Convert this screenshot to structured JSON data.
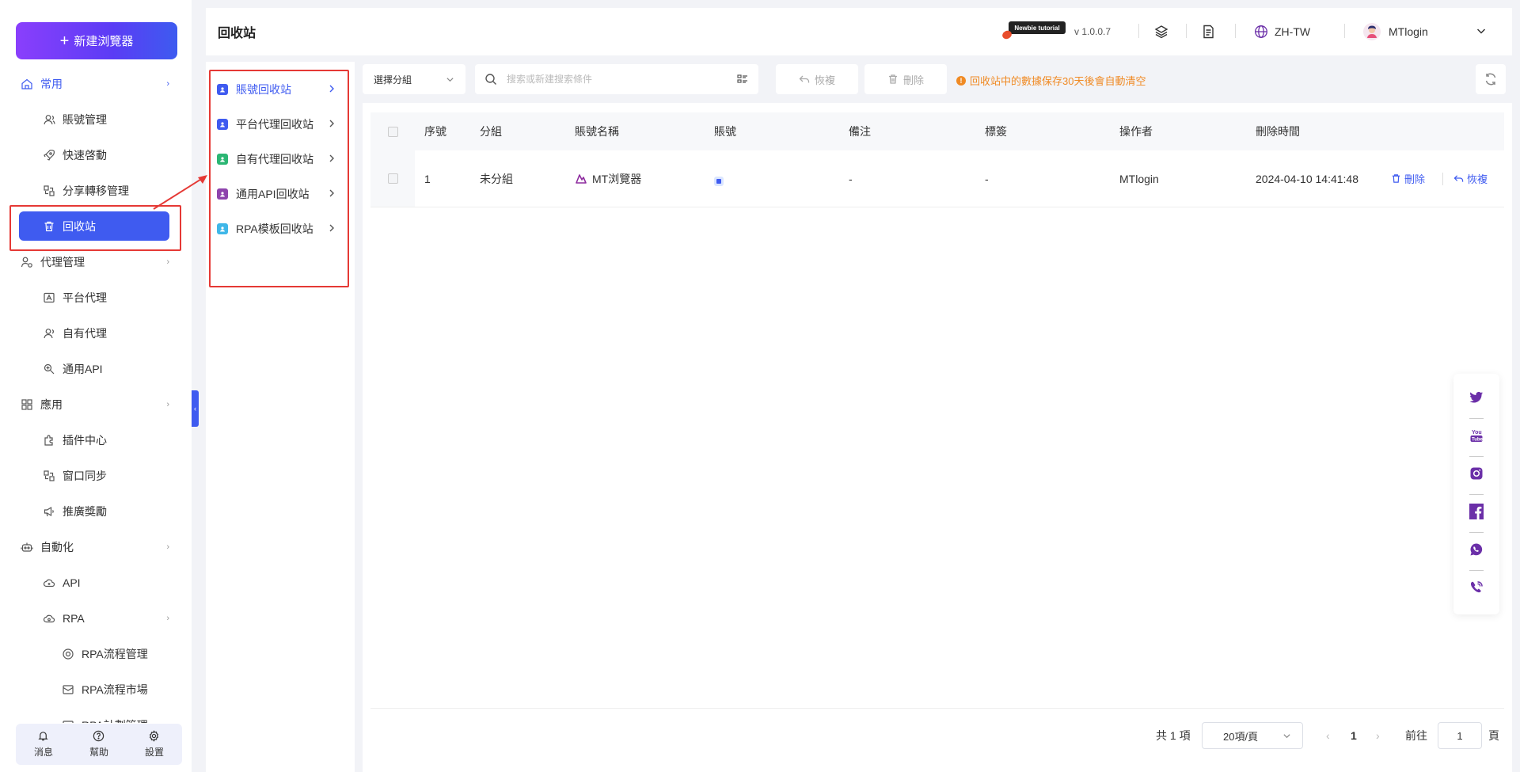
{
  "sidebar": {
    "new_browser": "新建浏覽器",
    "items": [
      {
        "label": "常用",
        "level": 1,
        "icon": "home-icon",
        "arrow": "›"
      },
      {
        "label": "賬號管理",
        "level": 2,
        "icon": "user-icon"
      },
      {
        "label": "快速啓動",
        "level": 2,
        "icon": "rocket-icon"
      },
      {
        "label": "分享轉移管理",
        "level": 2,
        "icon": "share-icon"
      },
      {
        "label": "回收站",
        "level": 2,
        "icon": "trash-icon",
        "active": true
      },
      {
        "label": "代理管理",
        "level": 1,
        "icon": "proxy-icon",
        "arrow": "›"
      },
      {
        "label": "平台代理",
        "level": 2,
        "icon": "platform-icon"
      },
      {
        "label": "自有代理",
        "level": 2,
        "icon": "user-proxy-icon"
      },
      {
        "label": "通用API",
        "level": 2,
        "icon": "api-icon"
      },
      {
        "label": "應用",
        "level": 1,
        "icon": "apps-icon",
        "arrow": "›"
      },
      {
        "label": "插件中心",
        "level": 2,
        "icon": "plugin-icon"
      },
      {
        "label": "窗口同步",
        "level": 2,
        "icon": "sync-icon"
      },
      {
        "label": "推廣獎勵",
        "level": 2,
        "icon": "megaphone-icon"
      },
      {
        "label": "自動化",
        "level": 1,
        "icon": "robot-icon",
        "arrow": "›"
      },
      {
        "label": "API",
        "level": 2,
        "icon": "cloud-icon"
      },
      {
        "label": "RPA",
        "level": 2,
        "icon": "rpa-icon",
        "arrow": "›"
      },
      {
        "label": "RPA流程管理",
        "level": 3,
        "icon": "flow-icon"
      },
      {
        "label": "RPA流程市場",
        "level": 3,
        "icon": "market-icon"
      },
      {
        "label": "RPA計劃管理",
        "level": 3,
        "icon": "plan-icon"
      }
    ],
    "bottom": [
      {
        "label": "消息",
        "icon": "bell-icon"
      },
      {
        "label": "幫助",
        "icon": "help-icon"
      },
      {
        "label": "設置",
        "icon": "gear-icon"
      }
    ],
    "collapse": "‹"
  },
  "header": {
    "title": "回收站",
    "tutorial": "Newbie tutorial",
    "version": "v 1.0.0.7",
    "language": "ZH-TW",
    "user": "MTlogin"
  },
  "subnav": [
    {
      "label": "賬號回收站",
      "active": true,
      "color": "#3f5bf0"
    },
    {
      "label": "平台代理回收站",
      "active": false,
      "color": "#3f5bf0"
    },
    {
      "label": "自有代理回收站",
      "active": false,
      "color": "#2bb673"
    },
    {
      "label": "通用API回收站",
      "active": false,
      "color": "#8e44ad"
    },
    {
      "label": "RPA模板回收站",
      "active": false,
      "color": "#3fb7e8"
    }
  ],
  "toolbar": {
    "group_select": "選擇分組",
    "search_placeholder": "搜索或新建搜索條件",
    "restore": "恢複",
    "delete": "刪除",
    "notice": "回收站中的數據保存30天後會自動清空"
  },
  "table": {
    "columns": [
      "序號",
      "分組",
      "賬號名稱",
      "賬號",
      "備注",
      "標簽",
      "操作者",
      "刪除時間"
    ],
    "rows": [
      {
        "index": "1",
        "group": "未分組",
        "name": "MT浏覽器",
        "account": "",
        "note": "-",
        "tag": "-",
        "operator": "MTlogin",
        "deleted_at": "2024-04-10 14:41:48"
      }
    ],
    "row_actions": {
      "delete": "刪除",
      "restore": "恢複"
    }
  },
  "pagination": {
    "total": "共 1 項",
    "page_size": "20項/頁",
    "current": "1",
    "goto_label": "前往",
    "goto_value": "1",
    "page_suffix": "頁"
  },
  "social": [
    "twitter-icon",
    "youtube-icon",
    "instagram-icon",
    "facebook-icon",
    "whatsapp-icon",
    "phone-icon"
  ],
  "colors": {
    "accent": "#3f5bf0",
    "gradient_start": "#8a3ffc",
    "warning": "#f08a24",
    "highlight": "#e53935",
    "social": "#6b2fa8"
  }
}
